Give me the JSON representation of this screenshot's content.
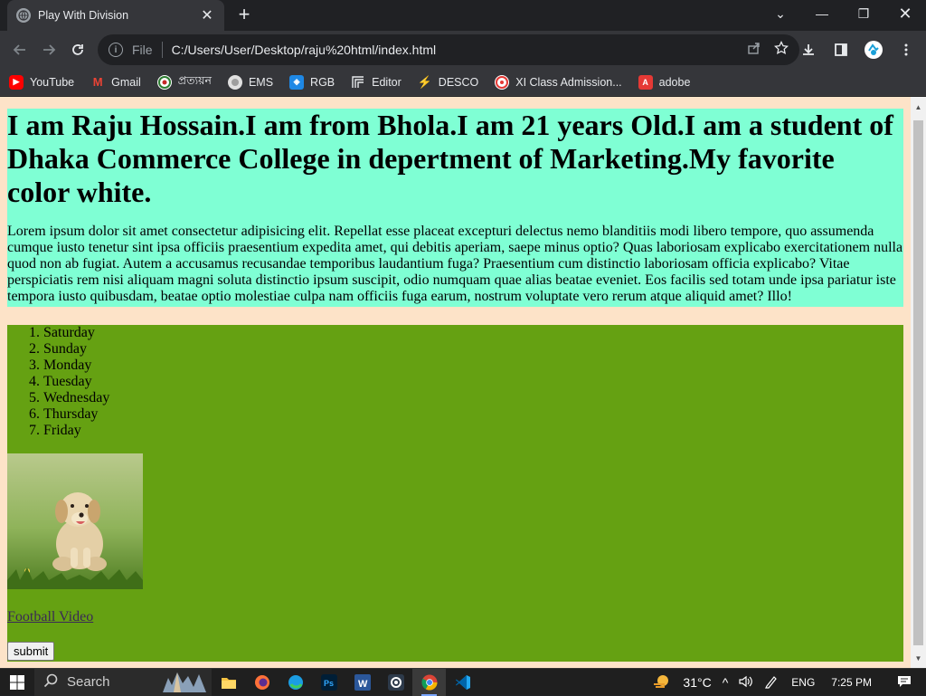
{
  "browser": {
    "tab_title": "Play With Division",
    "new_tab_symbol": "+",
    "url_scheme_label": "File",
    "url": "C:/Users/User/Desktop/raju%20html/index.html"
  },
  "bookmarks": [
    {
      "label": "YouTube",
      "icon": "youtube-icon",
      "color": "#ff0000"
    },
    {
      "label": "Gmail",
      "icon": "gmail-icon",
      "color": "#ea4335"
    },
    {
      "label": "প্রত্যয়ন",
      "icon": "seal-icon",
      "color": "#2e7d32"
    },
    {
      "label": "EMS",
      "icon": "ems-icon",
      "color": "#e0e0e0"
    },
    {
      "label": "RGB",
      "icon": "rgb-icon",
      "color": "#1e88e5"
    },
    {
      "label": "Editor",
      "icon": "editor-icon",
      "color": "#9e9e9e"
    },
    {
      "label": "DESCO",
      "icon": "bolt-icon",
      "color": "#e53935"
    },
    {
      "label": "XI Class Admission...",
      "icon": "admission-icon",
      "color": "#e53935"
    },
    {
      "label": "adobe",
      "icon": "adobe-icon",
      "color": "#e53935"
    }
  ],
  "page": {
    "heading": "I am Raju Hossain.I am from Bhola.I am 21 years Old.I am a student of Dhaka Commerce College in depertment of Marketing.My favorite color white.",
    "paragraph": "Lorem ipsum dolor sit amet consectetur adipisicing elit. Repellat esse placeat excepturi delectus nemo blanditiis modi libero tempore, quo assumenda cumque iusto tenetur sint ipsa officiis praesentium expedita amet, qui debitis aperiam, saepe minus optio? Quas laboriosam explicabo exercitationem nulla quod non ab fugiat. Autem a accusamus recusandae temporibus laudantium fuga? Praesentium cum distinctio laboriosam officia explicabo? Vitae perspiciatis rem nisi aliquam magni soluta distinctio ipsum suscipit, odio numquam quae alias beatae eveniet. Eos facilis sed totam unde ipsa pariatur iste tempora iusto quibusdam, beatae optio molestiae culpa nam officiis fuga earum, nostrum voluptate vero rerum atque aliquid amet? Illo!",
    "days": [
      "Saturday",
      "Sunday",
      "Monday",
      "Tuesday",
      "Wednesday",
      "Thursday",
      "Friday"
    ],
    "link_text": "Football Video",
    "submit_label": "submit",
    "colors": {
      "page_bg": "#fde3c8",
      "intro_bg": "#7fffd4",
      "green_bg": "#65a112"
    }
  },
  "taskbar": {
    "search_label": "Search",
    "apps": [
      "file-explorer-icon",
      "firefox-icon",
      "edge-icon",
      "photoshop-icon",
      "word-icon",
      "camera-icon",
      "chrome-icon",
      "vscode-icon"
    ],
    "weather": "31°C",
    "language": "ENG",
    "time": "7:25 PM"
  }
}
